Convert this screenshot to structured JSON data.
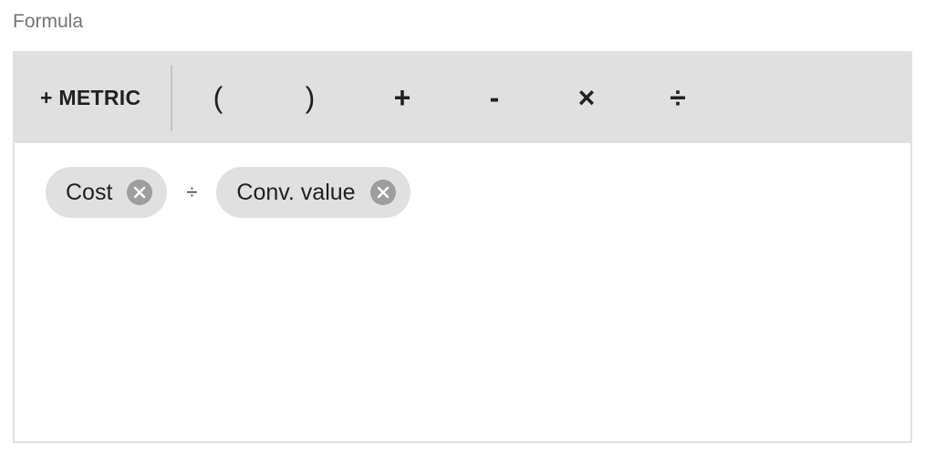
{
  "field": {
    "label": "Formula"
  },
  "toolbar": {
    "metric_label": "+ METRIC",
    "operators": [
      "(",
      ")",
      "+",
      "-",
      "×",
      "÷"
    ]
  },
  "expression": {
    "chips": [
      {
        "label": "Cost",
        "close_icon": "close-circle-icon"
      },
      {
        "label": "Conv. value",
        "close_icon": "close-circle-icon"
      }
    ],
    "operator": "÷"
  },
  "colors": {
    "toolbar_bg": "#e0e0e0",
    "chip_bg": "#e0e0e0",
    "chip_close_bg": "#9e9e9e",
    "label_text": "#757575"
  }
}
